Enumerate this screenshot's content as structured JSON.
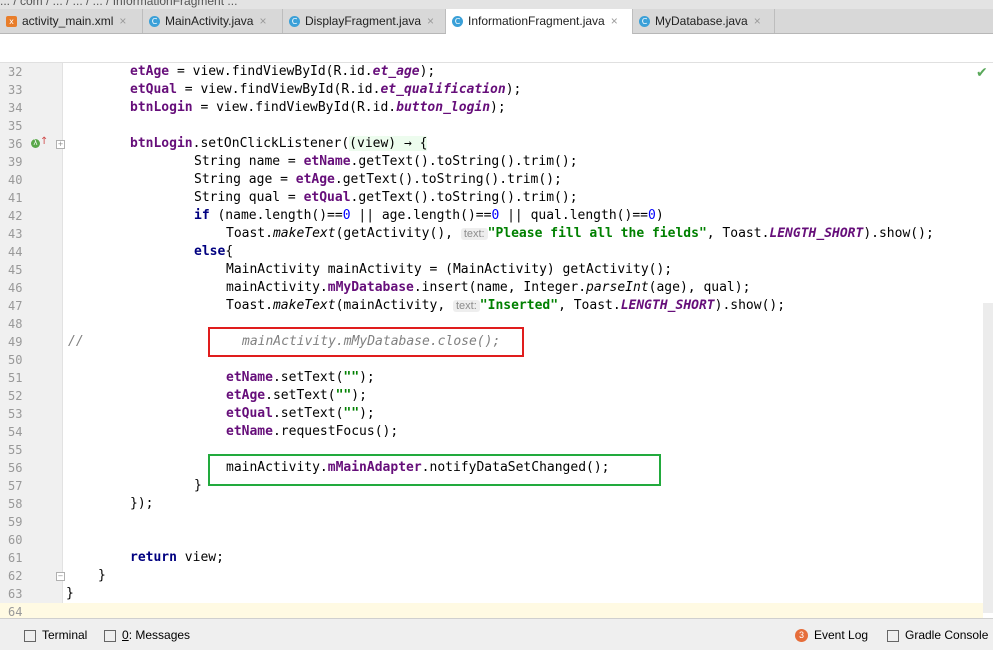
{
  "breadcrumbs": "... / com / ... / ... / ... / InformationFragment ...",
  "tabs": [
    {
      "label": "activity_main.xml",
      "icon": "xml-file-icon",
      "active": false
    },
    {
      "label": "MainActivity.java",
      "icon": "java-class-icon",
      "active": false
    },
    {
      "label": "DisplayFragment.java",
      "icon": "java-class-icon",
      "active": false
    },
    {
      "label": "InformationFragment.java",
      "icon": "java-class-icon",
      "active": true
    },
    {
      "label": "MyDatabase.java",
      "icon": "java-class-icon",
      "active": false
    }
  ],
  "tab_close_glyph": "×",
  "editor": {
    "line_numbers": [
      "32",
      "33",
      "34",
      "35",
      "36",
      "39",
      "40",
      "41",
      "42",
      "43",
      "44",
      "45",
      "46",
      "47",
      "48",
      "49",
      "50",
      "51",
      "52",
      "53",
      "54",
      "55",
      "56",
      "57",
      "58",
      "59",
      "60",
      "61",
      "62",
      "63",
      "64"
    ],
    "code": {
      "l32": {
        "a": "etAge",
        "b": " = view.findViewById(R.id.",
        "c": "et_age",
        "d": ");"
      },
      "l33": {
        "a": "etQual",
        "b": " = view.findViewById(R.id.",
        "c": "et_qualification",
        "d": ");"
      },
      "l34": {
        "a": "btnLogin",
        "b": " = view.findViewById(R.id.",
        "c": "button_login",
        "d": ");"
      },
      "l36": {
        "a": "btnLogin",
        "b": ".setOnClickListener(",
        "c": "(view) → {"
      },
      "l39": {
        "a": "String name = ",
        "b": "etName",
        "c": ".getText().toString().trim();"
      },
      "l40": {
        "a": "String age = ",
        "b": "etAge",
        "c": ".getText().toString().trim();"
      },
      "l41": {
        "a": "String qual = ",
        "b": "etQual",
        "c": ".getText().toString().trim();"
      },
      "l42": {
        "kw": "if",
        "a": " (name.length()==",
        "n1": "0",
        "b": " || age.length()==",
        "n2": "0",
        "c": " || qual.length()==",
        "n3": "0",
        "d": ")"
      },
      "l43": {
        "a": "Toast.",
        "b": "makeText",
        "c": "(getActivity(), ",
        "hint": "text:",
        "str": "\"Please fill all the fields\"",
        "d": ", Toast.",
        "e": "LENGTH_SHORT",
        "f": ").show();"
      },
      "l44": {
        "kw": "else",
        "a": "{"
      },
      "l45": {
        "a": "MainActivity mainActivity = (MainActivity) getActivity();"
      },
      "l46": {
        "a": "mainActivity.",
        "b": "mMyDatabase",
        "c": ".insert(name, Integer.",
        "d": "parseInt",
        "e": "(age), qual);"
      },
      "l47": {
        "a": "Toast.",
        "b": "makeText",
        "c": "(mainActivity, ",
        "hint": "text:",
        "str": "\"Inserted\"",
        "d": ", Toast.",
        "e": "LENGTH_SHORT",
        "f": ").show();"
      },
      "l49": {
        "a": "//",
        "b": "mainActivity.mMyDatabase.close();"
      },
      "l51": {
        "a": "etName",
        "b": ".setText(",
        "s": "\"\"",
        "c": ");"
      },
      "l52": {
        "a": "etAge",
        "b": ".setText(",
        "s": "\"\"",
        "c": ");"
      },
      "l53": {
        "a": "etQual",
        "b": ".setText(",
        "s": "\"\"",
        "c": ");"
      },
      "l54": {
        "a": "etName",
        "b": ".requestFocus();"
      },
      "l56": {
        "a": "mainActivity.",
        "b": "mMainAdapter",
        "c": ".notifyDataSetChanged();"
      },
      "l57": {
        "a": "}"
      },
      "l58": {
        "a": "});"
      },
      "l61": {
        "kw": "return",
        "a": " view;"
      },
      "l62": {
        "a": "}"
      },
      "l63": {
        "a": "}"
      }
    }
  },
  "status_bar": {
    "terminal": "Terminal",
    "messages_prefix": "0",
    "messages": ": Messages",
    "event_log_badge": "3",
    "event_log": "Event Log",
    "gradle_console": "Gradle Console"
  },
  "colors": {
    "red_box": "#e01d1d",
    "green_box": "#22aa3d"
  }
}
